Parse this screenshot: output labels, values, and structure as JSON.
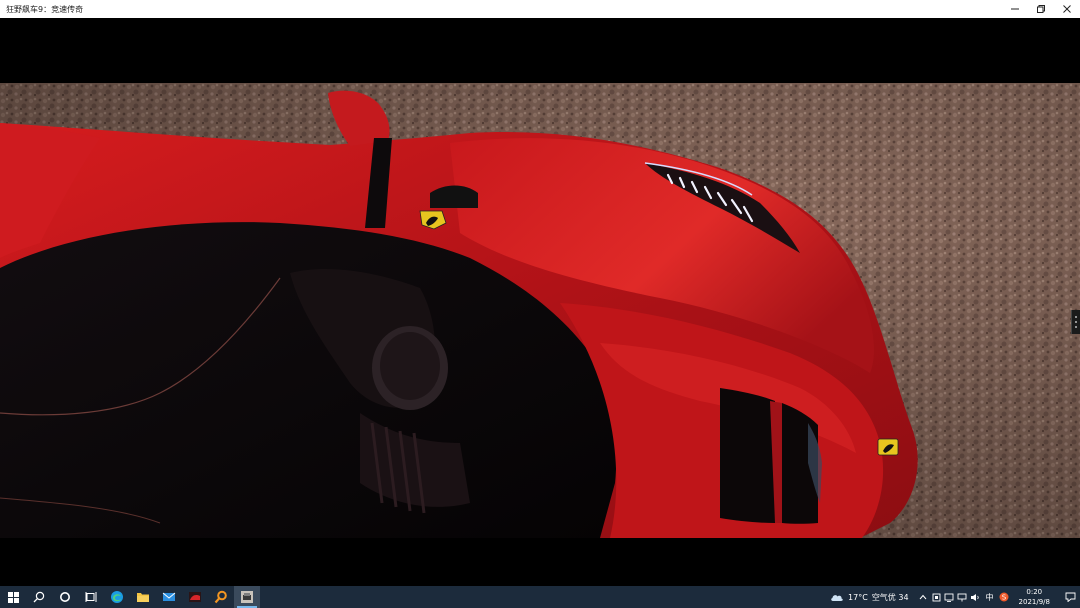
{
  "window": {
    "title": "狂野飙车9：竞速传奇"
  },
  "window_controls": {
    "minimize_icon": "minimize-icon",
    "restore_icon": "restore-icon",
    "close_icon": "close-icon"
  },
  "colors": {
    "car_red": "#c0161a",
    "ground": "#8a6a5c",
    "taskbar": "#1c2b3c",
    "titlebar": "#ffffff"
  },
  "taskbar": {
    "apps": [
      {
        "name": "start",
        "icon": "windows-start-icon"
      },
      {
        "name": "search",
        "icon": "search-icon"
      },
      {
        "name": "cortana",
        "icon": "cortana-circle-icon"
      },
      {
        "name": "task-view",
        "icon": "task-view-icon"
      },
      {
        "name": "edge",
        "icon": "edge-browser-icon"
      },
      {
        "name": "file-explorer",
        "icon": "folder-icon"
      },
      {
        "name": "mail",
        "icon": "mail-icon"
      },
      {
        "name": "game-launcher",
        "icon": "red-game-icon"
      },
      {
        "name": "search-app",
        "icon": "orange-search-icon"
      },
      {
        "name": "asphalt9",
        "icon": "game-car-icon",
        "active": true
      }
    ],
    "tray": {
      "weather_temp": "17°C",
      "air_quality": "空气优 34",
      "ime": "中",
      "time": "0:20",
      "date": "2021/9/8"
    }
  }
}
